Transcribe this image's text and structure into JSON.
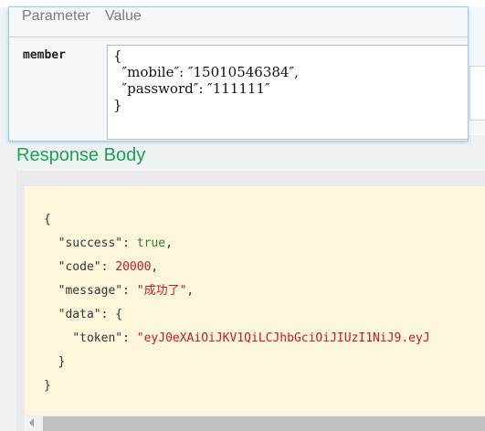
{
  "params": {
    "header_parameter": "Parameter",
    "header_value": "Value",
    "row_name": "member",
    "row_value": "{\n  ″mobile″: ″15010546384″,\n  ″password″: ″111111″\n}"
  },
  "response": {
    "title": "Response Body",
    "lines": {
      "open": "{",
      "success_key": "\"success\"",
      "success_val": "true",
      "code_key": "\"code\"",
      "code_val": "20000",
      "message_key": "\"message\"",
      "message_val": "\"成功了\"",
      "data_key": "\"data\"",
      "data_open": "{",
      "token_key": "\"token\"",
      "token_val": "\"eyJ0eXAiOiJKV1QiLCJhbGciOiJIUzI1NiJ9.eyJ",
      "data_close": "}",
      "close": "}"
    }
  },
  "colors": {
    "title_green": "#1ba34d",
    "string_red": "#c4172c",
    "bool_green": "#2e7d32",
    "code_background": "#fcf6db",
    "panel_border": "#9fc9e3"
  }
}
